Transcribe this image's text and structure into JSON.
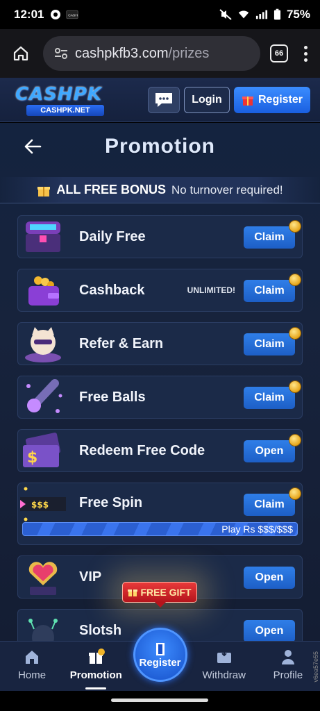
{
  "status_bar": {
    "time": "12:01",
    "battery": "75%"
  },
  "browser": {
    "url_host": "cashpkfb3.com",
    "url_path": "/prizes",
    "tab_count": "66"
  },
  "header": {
    "logo_text": "CASHPK",
    "logo_sub": "CASHPK.NET",
    "login_label": "Login",
    "register_label": "Register"
  },
  "page": {
    "title": "Promotion",
    "bonus_title": "ALL FREE BONUS",
    "bonus_note": "No turnover required!"
  },
  "promotions": [
    {
      "name": "Daily Free",
      "tag": "",
      "action": "Claim"
    },
    {
      "name": "Cashback",
      "tag": "UNLIMITED!",
      "action": "Claim"
    },
    {
      "name": "Refer & Earn",
      "tag": "",
      "action": "Claim"
    },
    {
      "name": "Free Balls",
      "tag": "",
      "action": "Claim"
    },
    {
      "name": "Redeem Free Code",
      "tag": "",
      "action": "Open"
    },
    {
      "name": "Free Spin",
      "tag": "",
      "action": "Claim",
      "icon_text": "$$$",
      "progress_text": "Play Rs $$$/$$$"
    },
    {
      "name": "VIP",
      "tag": "",
      "action": "Open"
    },
    {
      "name": "Slotsh",
      "tag": "",
      "action": "Open"
    }
  ],
  "free_gift_label": "FREE GIFT",
  "bottom_nav": {
    "home": "Home",
    "promotion": "Promotion",
    "register": "Register",
    "withdraw": "Withdraw",
    "profile": "Profile"
  },
  "side_code": "v6ea57e55",
  "colors": {
    "accent": "#2f7ee8",
    "background": "#14233f",
    "card": "#1b2a48",
    "gift": "#d62a2f"
  }
}
